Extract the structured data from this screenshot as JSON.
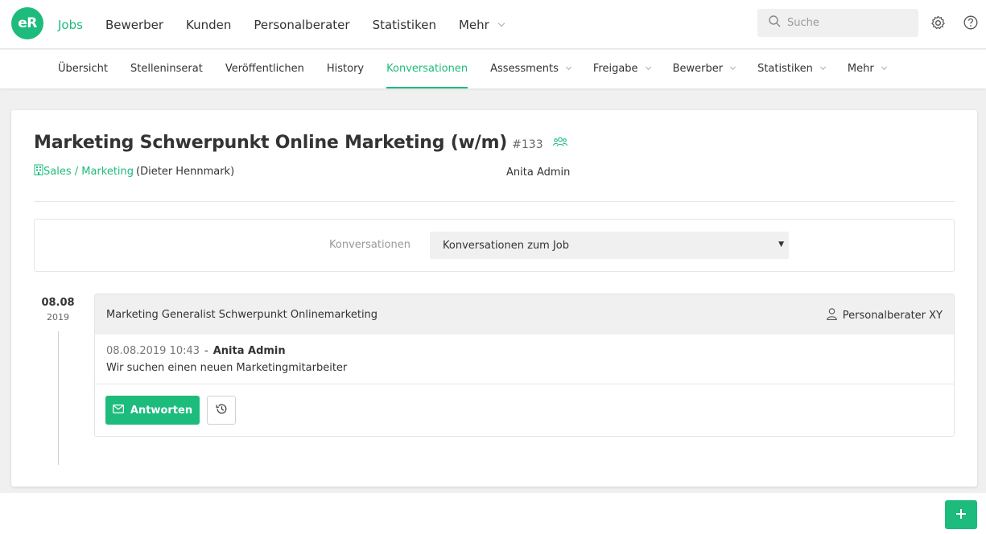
{
  "app": {
    "logo_text": "eR"
  },
  "main_nav": {
    "items": [
      {
        "label": "Jobs",
        "active": true
      },
      {
        "label": "Bewerber"
      },
      {
        "label": "Kunden"
      },
      {
        "label": "Personalberater"
      },
      {
        "label": "Statistiken"
      },
      {
        "label": "Mehr",
        "dropdown": true
      }
    ]
  },
  "search": {
    "placeholder": "Suche",
    "icon": "search-icon"
  },
  "top_icons": {
    "settings": "gear-icon",
    "help": "help-icon"
  },
  "sub_nav": {
    "items": [
      {
        "label": "Übersicht"
      },
      {
        "label": "Stelleninserat"
      },
      {
        "label": "Veröffentlichen"
      },
      {
        "label": "History"
      },
      {
        "label": "Konversationen",
        "active": true
      },
      {
        "label": "Assessments",
        "dropdown": true
      },
      {
        "label": "Freigabe",
        "dropdown": true
      },
      {
        "label": "Bewerber",
        "dropdown": true
      },
      {
        "label": "Statistiken",
        "dropdown": true
      },
      {
        "label": "Mehr",
        "dropdown": true
      }
    ]
  },
  "job": {
    "title": "Marketing Schwerpunkt Online Marketing (w/m)",
    "id": "#133",
    "department": "Sales / Marketing",
    "contact": "(Dieter Hennmark)",
    "owner": "Anita Admin"
  },
  "filter": {
    "label": "Konversationen",
    "selected": "Konversationen zum Job"
  },
  "conversations": [
    {
      "date_day": "08.08",
      "date_year": "2019",
      "subject": "Marketing Generalist Schwerpunkt Onlinemarketing",
      "assignee": "Personalberater XY",
      "message": {
        "timestamp": "08.08.2019 10:43",
        "separator": "-",
        "author": "Anita Admin",
        "text": "Wir suchen einen neuen Marketingmitarbeiter"
      },
      "reply_label": "Antworten"
    }
  ],
  "colors": {
    "accent": "#1dbb7c",
    "background": "#f0f0f0",
    "text": "#333333"
  }
}
